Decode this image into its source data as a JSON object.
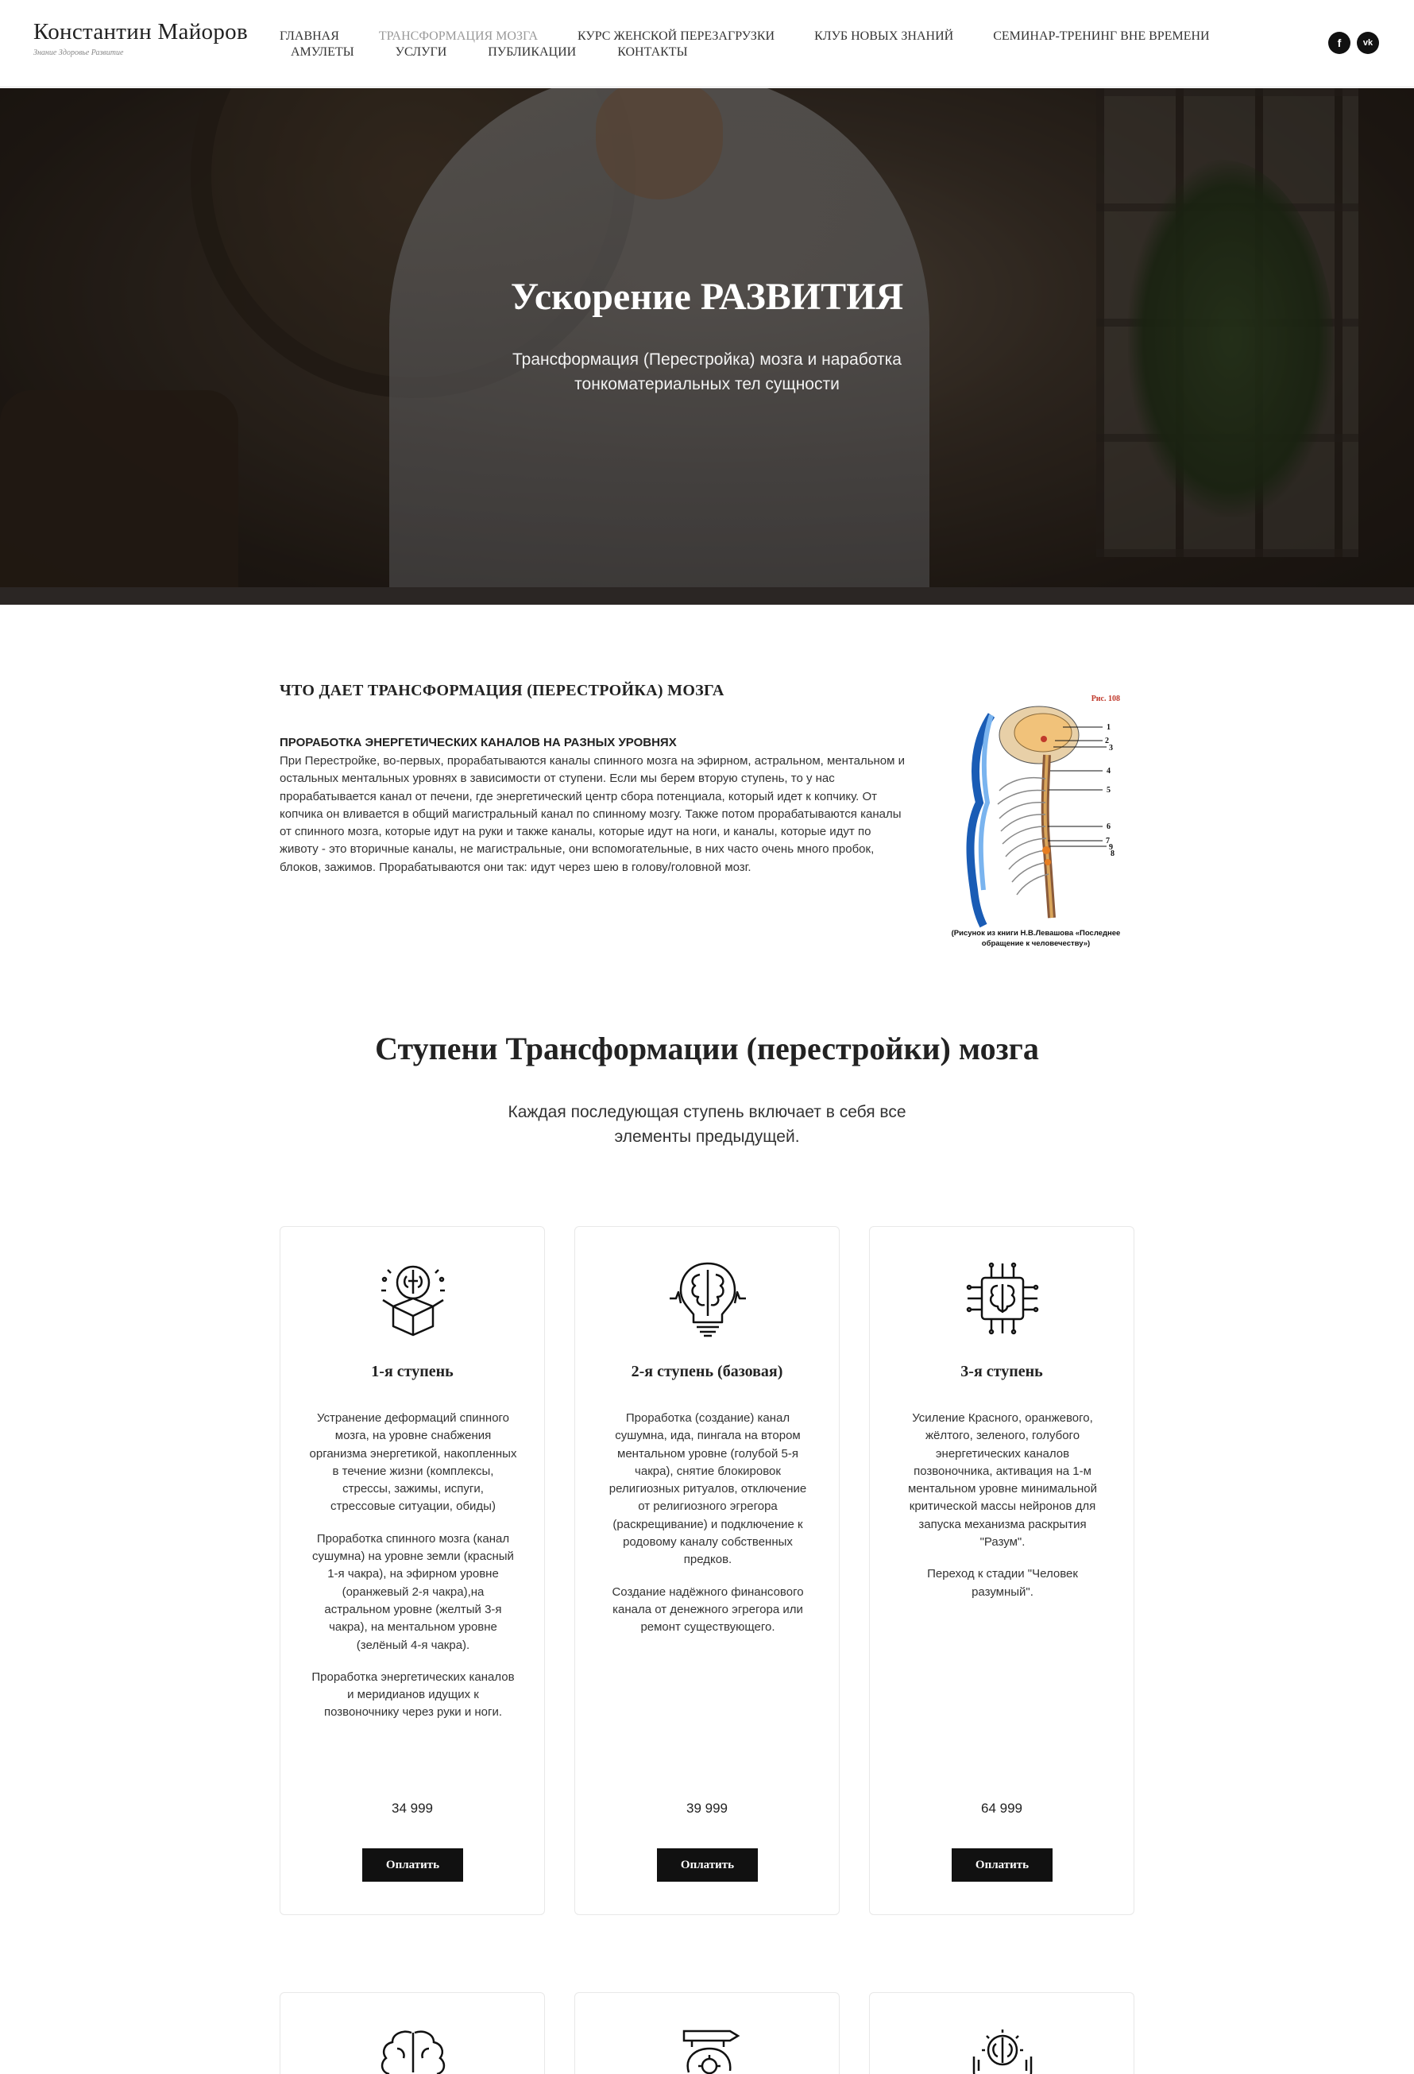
{
  "header": {
    "logo_name": "Константин Майоров",
    "logo_tagline": "Знание Здоровье Развитие",
    "nav_row1": [
      "Главная",
      "Трансформация мозга",
      "Курс женской перезагрузки",
      "Клуб новых знаний",
      "Семинар-тренинг вне времени"
    ],
    "nav_row2": [
      "Амулеты",
      "Услуги",
      "Публикации",
      "Контакты"
    ],
    "active_item": "Трансформация мозга",
    "social": {
      "facebook": "f",
      "vk": "vk"
    }
  },
  "hero": {
    "title": "Ускорение РАЗВИТИЯ",
    "subtitle": "Трансформация (Перестройка) мозга и наработка тонкоматериальных тел сущности"
  },
  "intro": {
    "title": "ЧТО ДАЕТ ТРАНСФОРМАЦИЯ (ПЕРЕСТРОЙКА) МОЗГА",
    "subtitle": "ПРОРАБОТКА ЭНЕРГЕТИЧЕСКИХ КАНАЛОВ НА РАЗНЫХ УРОВНЯХ",
    "text": "При Перестройке, во-первых, прорабатываются каналы спинного мозга на эфирном, астральном, ментальном и остальных ментальных уровнях в зависимости от ступени. Если мы берем вторую ступень, то у нас прорабатывается канал от печени, где энергетический центр сбора потенциала, который идет к копчику. От копчика он вливается в общий магистральный канал по спинному мозгу. Также потом прорабатываются каналы от спинного мозга, которые идут на руки и также каналы, которые идут на ноги, и каналы, которые идут по животу - это вторичные каналы, не магистральные, они вспомогательные, в них часто очень много пробок, блоков, зажимов. Прорабатываются они так: идут через шею в голову/головной мозг.",
    "figure_number": "Рис. 108",
    "figure_labels": [
      "1",
      "2",
      "3",
      "4",
      "5",
      "6",
      "7",
      "9",
      "8"
    ],
    "figure_caption": "(Рисунок из книги Н.В.Левашова «Последнее обращение к человечеству»)"
  },
  "steps": {
    "title": "Ступени Трансформации (перестройки) мозга",
    "subtitle": "Каждая последующая ступень включает в себя все элементы предыдущей.",
    "cards": [
      {
        "icon": "brain-box-icon",
        "title": "1-я ступень",
        "paragraphs": [
          "Устранение деформаций спинного мозга, на уровне снабжения организма энергетикой, накопленных в течение жизни (комплексы, стрессы, зажимы, испуги, стрессовые ситуации, обиды)",
          "Проработка спинного мозга (канал сушумна) на уровне земли (красный 1-я чакра), на эфирном уровне (оранжевый 2-я чакра),на астральном уровне (желтый 3-я чакра), на ментальном уровне (зелёный 4-я чакра).",
          "Проработка энергетических каналов и меридианов идущих к позвоночнику через руки и ноги."
        ],
        "price": "34 999",
        "button": "Оплатить"
      },
      {
        "icon": "brain-bulb-icon",
        "title": "2-я ступень (базовая)",
        "paragraphs": [
          "Проработка (создание) канал сушумна, ида, пингала на втором ментальном уровне (голубой 5-я чакра), снятие блокировок религиозных ритуалов, отключение от религиозного эгрегора (раскрещивание) и подключение к родовому каналу собственных предков.",
          "Создание надёжного финансового канала от денежного эгрегора или ремонт существующего."
        ],
        "price": "39 999",
        "button": "Оплатить"
      },
      {
        "icon": "brain-chip-icon",
        "title": "3-я ступень",
        "paragraphs": [
          "Усиление Красного, оранжевого, жёлтого, зеленого, голубого энергетических каналов позвоночника, активация на 1-м ментальном уровне минимальной критической массы нейронов для запуска механизма раскрытия \"Разум\".",
          "Переход к стадии \"Человек разумный\"."
        ],
        "price": "64 999",
        "button": "Оплатить"
      }
    ],
    "more_cards_icons": [
      "brain-icon",
      "head-gear-icon",
      "brain-hands-icon"
    ]
  },
  "colors": {
    "accent": "#111111",
    "text": "#222222",
    "muted": "#999999"
  }
}
